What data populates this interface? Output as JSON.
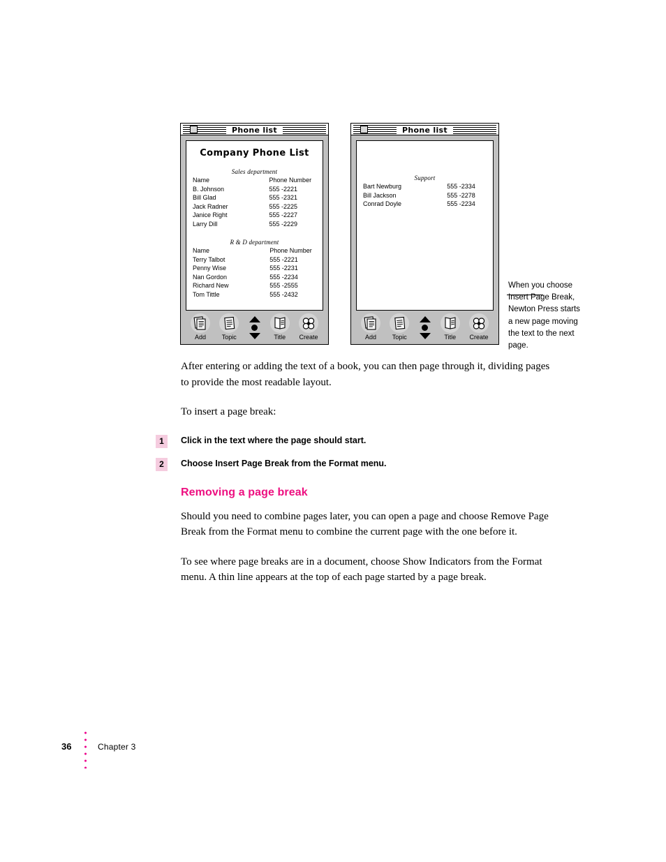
{
  "figure": {
    "windows": [
      {
        "title": "Phone list",
        "doc_title": "Company Phone List",
        "sections": [
          {
            "heading": "Sales department",
            "col_name": "Name",
            "col_phone": "Phone Number",
            "rows": [
              {
                "name": "B. Johnson",
                "phone": "555 -2221"
              },
              {
                "name": "Bill Glad",
                "phone": "555 -2321"
              },
              {
                "name": "Jack Radner",
                "phone": "555 -2225"
              },
              {
                "name": "Janice Right",
                "phone": "555 -2227"
              },
              {
                "name": "Larry Dill",
                "phone": "555 -2229"
              }
            ]
          },
          {
            "heading": "R & D department",
            "col_name": "Name",
            "col_phone": "Phone Number",
            "rows": [
              {
                "name": "Terry Talbot",
                "phone": "555 -2221"
              },
              {
                "name": "Penny Wise",
                "phone": "555 -2231"
              },
              {
                "name": "Nan Gordon",
                "phone": "555 -2234"
              },
              {
                "name": "Richard New",
                "phone": "555 -2555"
              },
              {
                "name": "Tom Tittle",
                "phone": "555 -2432"
              }
            ]
          }
        ],
        "toolbar": [
          {
            "label": "Add",
            "icon": "add-pages-icon"
          },
          {
            "label": "Topic",
            "icon": "topic-page-icon"
          },
          {
            "label": "",
            "icon": "scroll-arrows-icon"
          },
          {
            "label": "Title",
            "icon": "title-book-icon"
          },
          {
            "label": "Create",
            "icon": "create-flower-icon"
          }
        ]
      },
      {
        "title": "Phone list",
        "doc_title": "",
        "sections": [
          {
            "heading": "Support",
            "col_name": "",
            "col_phone": "",
            "rows": [
              {
                "name": "Bart Newburg",
                "phone": "555 -2334"
              },
              {
                "name": "Bill Jackson",
                "phone": "555 -2278"
              },
              {
                "name": "Conrad Doyle",
                "phone": "555 -2234"
              }
            ]
          }
        ],
        "toolbar": [
          {
            "label": "Add",
            "icon": "add-pages-icon"
          },
          {
            "label": "Topic",
            "icon": "topic-page-icon"
          },
          {
            "label": "",
            "icon": "scroll-arrows-icon"
          },
          {
            "label": "Title",
            "icon": "title-book-icon"
          },
          {
            "label": "Create",
            "icon": "create-flower-icon"
          }
        ]
      }
    ],
    "callout": "When you choose Insert Page Break, Newton Press starts a new page moving the text to the next page."
  },
  "content": {
    "intro_paragraph": "After entering or adding the text of a book, you can then page through it, dividing pages to provide the most readable layout.",
    "lead_in": "To insert a page break:",
    "steps": [
      {
        "number": "1",
        "text": "Click in the text where the page should start."
      },
      {
        "number": "2",
        "text": "Choose Insert Page Break from the Format menu."
      }
    ],
    "section_heading": "Removing a page break",
    "paragraph_1": "Should you need to combine pages later, you can open a page and choose Remove Page Break from the Format menu to combine the current page with the one before it.",
    "paragraph_2": "To see where page breaks are in a document, choose Show Indicators from the Format menu. A thin line appears at the top of each page started by a page break."
  },
  "footer": {
    "page_number": "36",
    "chapter": "Chapter 3"
  },
  "colors": {
    "heading_magenta": "#ed0f80",
    "step_badge_pink": "#f5ccdf",
    "footer_dots": "#ec008c",
    "window_chrome": "#c0c0c0"
  }
}
